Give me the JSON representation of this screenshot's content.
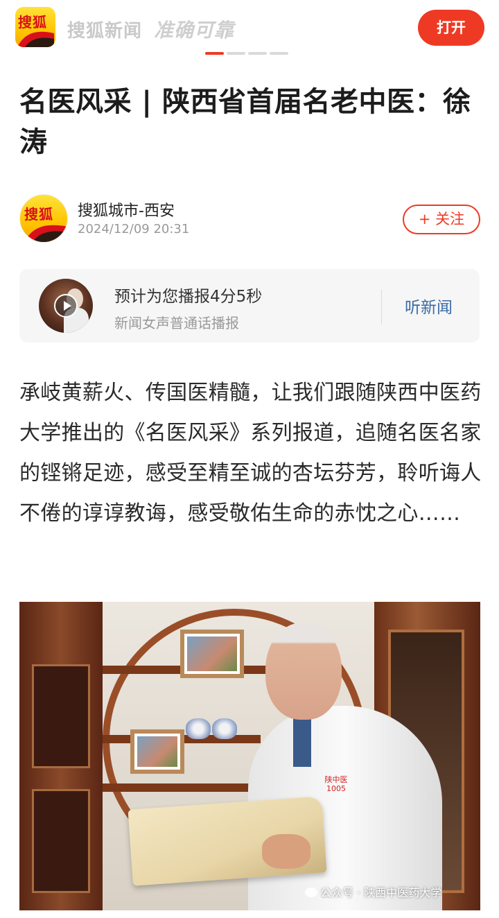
{
  "header": {
    "app_logo_text": "搜狐",
    "brand": "搜狐新闻",
    "slogan": "准确可靠",
    "open_label": "打开",
    "pager_count": 4,
    "pager_active": 1
  },
  "article": {
    "title": "名医风采 | 陕西省首届名老中医：徐涛",
    "author": {
      "avatar_text": "搜狐",
      "name": "搜狐城市-西安",
      "time": "2024/12/09 20:31",
      "follow_label": "+ 关注"
    },
    "audio": {
      "main": "预计为您播报4分5秒",
      "sub": "新闻女声普通话播报",
      "listen_label": "听新闻"
    },
    "body": "承岐黄薪火、传国医精髓，让我们跟随陕西中医药大学推出的《名医风采》系列报道，追随名医名家的铿锵足迹，感受至精至诚的杏坛芬芳，聆听诲人不倦的谆谆教诲，感受敬佑生命的赤忱之心……",
    "photo": {
      "watermark": "公众号 · 陕西中医药大学",
      "badge_text": "陕中医 1005"
    }
  },
  "colors": {
    "accent": "#ee3a24",
    "link": "#3a6aa8",
    "muted": "#999999"
  }
}
